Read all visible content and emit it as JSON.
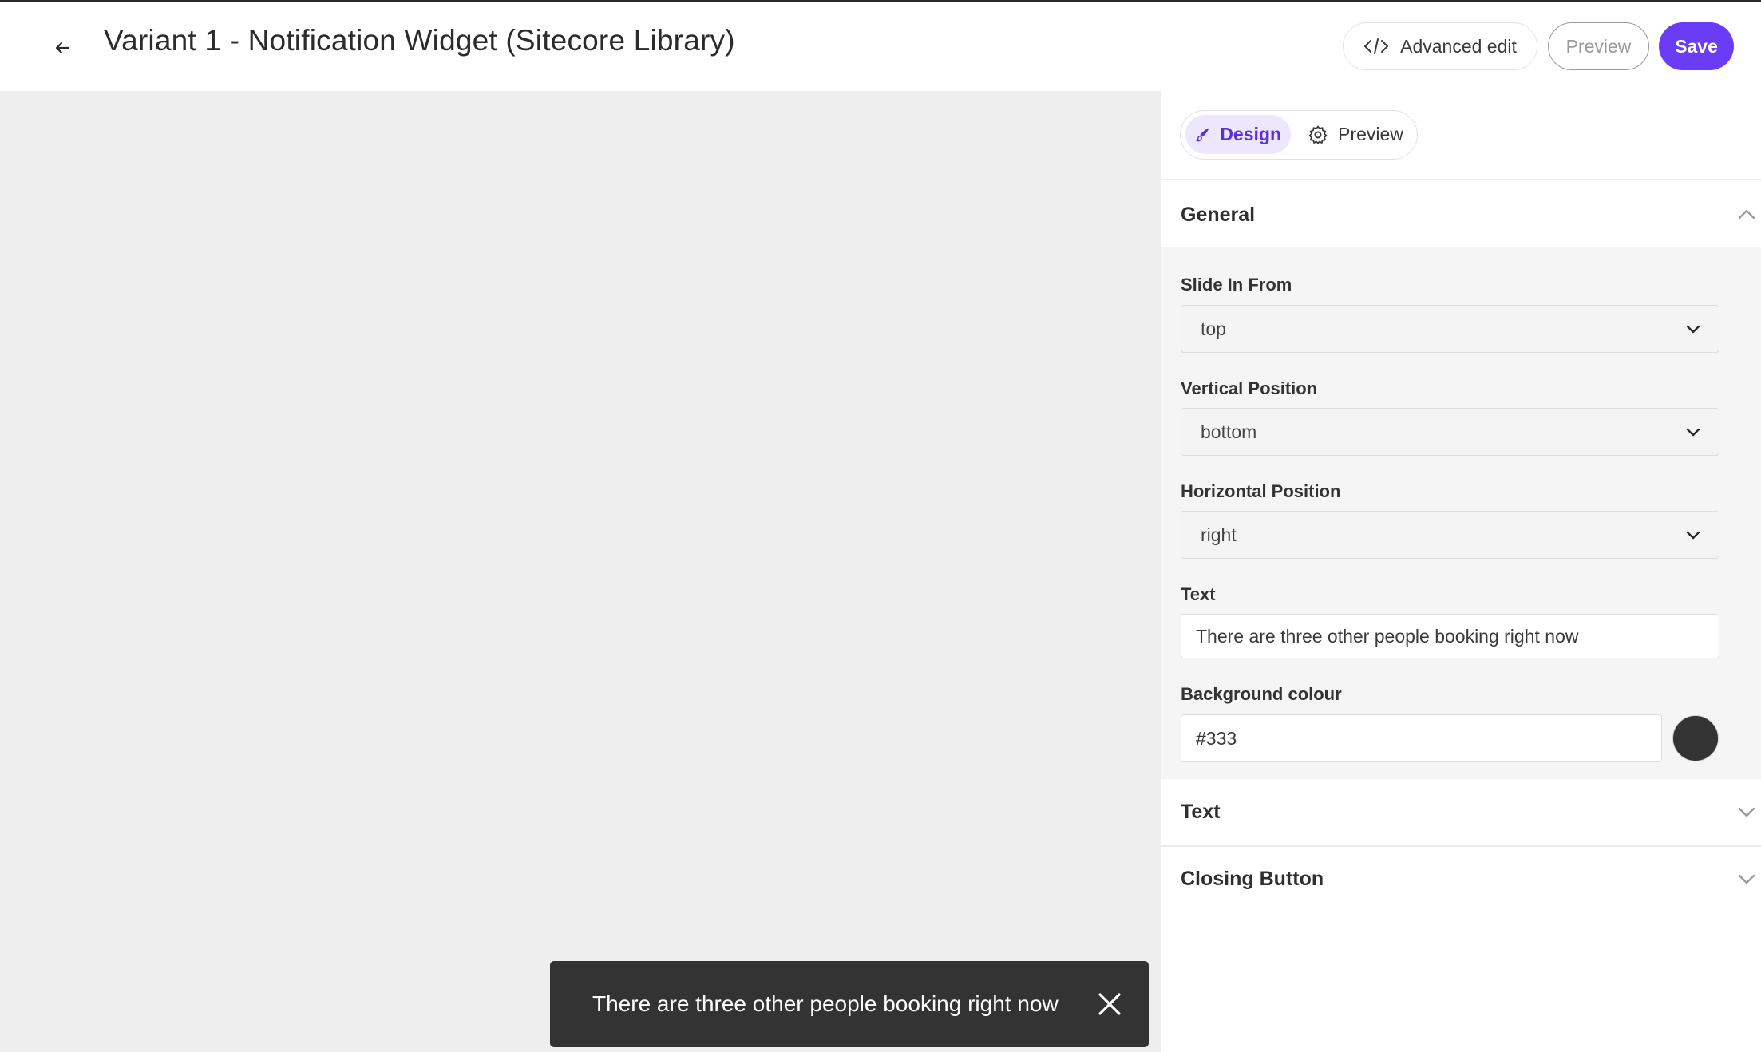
{
  "header": {
    "title": "Variant 1 - Notification Widget (Sitecore Library)",
    "advanced_edit_label": "Advanced edit",
    "preview_label": "Preview",
    "save_label": "Save"
  },
  "canvas": {
    "notification": {
      "text": "There are three other people booking right now",
      "background": "#333333"
    }
  },
  "panel": {
    "tabs": [
      {
        "label": "Design",
        "active": true
      },
      {
        "label": "Preview",
        "active": false
      }
    ],
    "sections": {
      "general": {
        "title": "General",
        "expanded": true,
        "fields": {
          "slide_in_from": {
            "label": "Slide In From",
            "value": "top"
          },
          "vertical_position": {
            "label": "Vertical Position",
            "value": "bottom"
          },
          "horizontal_position": {
            "label": "Horizontal Position",
            "value": "right"
          },
          "text": {
            "label": "Text",
            "value": "There are three other people booking right now"
          },
          "background_colour": {
            "label": "Background colour",
            "value": "#333",
            "swatch": "#333333"
          }
        }
      },
      "text": {
        "title": "Text",
        "expanded": false
      },
      "closing_button": {
        "title": "Closing Button",
        "expanded": false
      }
    }
  },
  "colors": {
    "accent": "#6a3cf5",
    "active_tab_bg": "#ece7fd",
    "canvas_bg": "#eeeeee"
  },
  "icons": {
    "back": "arrow-left-icon",
    "advanced_edit": "code-icon",
    "design_tab": "brush-icon",
    "preview_tab": "gear-icon",
    "collapse": "chevron-up-icon",
    "expand": "chevron-down-icon",
    "close": "close-icon"
  }
}
